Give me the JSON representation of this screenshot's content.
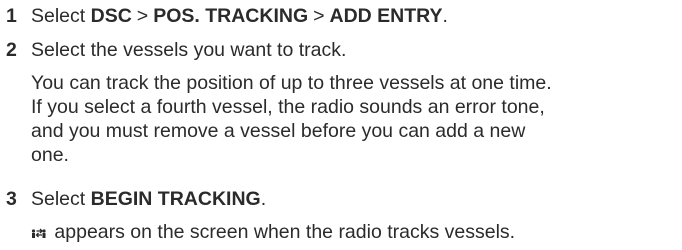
{
  "steps": [
    {
      "number": "1",
      "prefix": "Select ",
      "path": [
        "DSC",
        "POS. TRACKING",
        "ADD ENTRY"
      ],
      "separator": ">",
      "suffix": "."
    },
    {
      "number": "2",
      "text": "Select the vessels you want to track.",
      "note_lines": [
        "You can track the position of up to three vessels at one time.",
        "If you select a fourth vessel, the radio sounds an error tone,",
        "and you must remove a vessel before you can add a new",
        "one."
      ]
    },
    {
      "number": "3",
      "prefix": "Select ",
      "bold": "BEGIN TRACKING",
      "suffix": ".",
      "note_icon": "vessel-tracking-icon",
      "note_text": " appears on the screen when the radio tracks vessels."
    }
  ]
}
